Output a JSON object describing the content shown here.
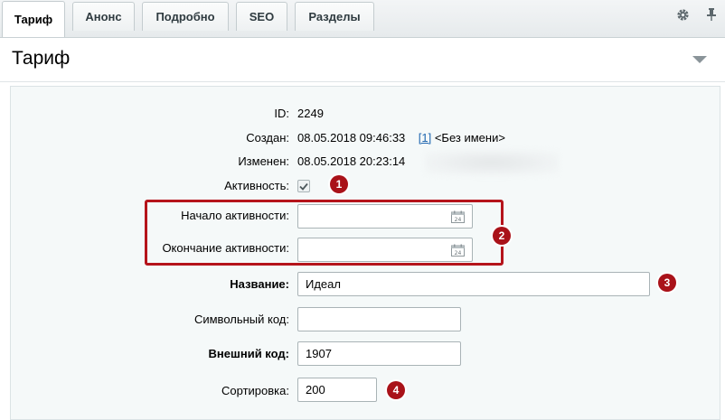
{
  "tabs": [
    {
      "label": "Тариф",
      "active": true
    },
    {
      "label": "Анонс",
      "active": false
    },
    {
      "label": "Подробно",
      "active": false
    },
    {
      "label": "SEO",
      "active": false
    },
    {
      "label": "Разделы",
      "active": false
    }
  ],
  "toolbar_icons": [
    "gear-icon",
    "pin-icon"
  ],
  "section": {
    "title": "Тариф"
  },
  "fields": {
    "id": {
      "label": "ID:",
      "value": "2249"
    },
    "created": {
      "label": "Создан:",
      "value": "08.05.2018 09:46:33",
      "user_link": "[1]",
      "user_name": "<Без имени>"
    },
    "modified": {
      "label": "Изменен:",
      "value": "08.05.2018 20:23:14"
    },
    "active": {
      "label": "Активность:",
      "checked": true
    },
    "active_from": {
      "label": "Начало активности:",
      "value": ""
    },
    "active_to": {
      "label": "Окончание активности:",
      "value": ""
    },
    "name": {
      "label": "Название:",
      "value": "Идеал"
    },
    "code": {
      "label": "Символьный код:",
      "value": ""
    },
    "xml_id": {
      "label": "Внешний код:",
      "value": "1907"
    },
    "sort": {
      "label": "Сортировка:",
      "value": "200"
    }
  },
  "badges": [
    "1",
    "2",
    "3",
    "4"
  ],
  "colors": {
    "highlight": "#b5141b",
    "badge": "#a91219",
    "link": "#2067b0"
  }
}
